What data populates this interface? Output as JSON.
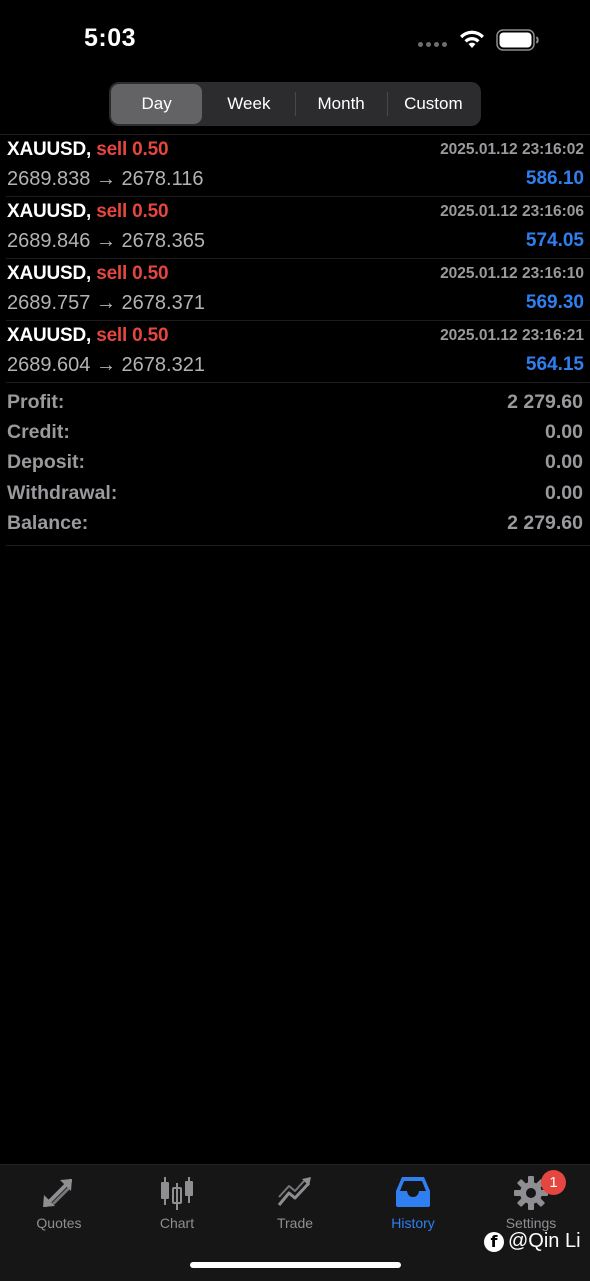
{
  "status_bar": {
    "time": "5:03"
  },
  "segments": [
    {
      "label": "Day",
      "active": true
    },
    {
      "label": "Week",
      "active": false
    },
    {
      "label": "Month",
      "active": false
    },
    {
      "label": "Custom",
      "active": false
    }
  ],
  "deals": [
    {
      "symbol": "XAUUSD,",
      "side": "sell 0.50",
      "time": "2025.01.12 23:16:02",
      "open": "2689.838",
      "arrow": "→",
      "close": "2678.116",
      "profit": "586.10"
    },
    {
      "symbol": "XAUUSD,",
      "side": "sell 0.50",
      "time": "2025.01.12 23:16:06",
      "open": "2689.846",
      "arrow": "→",
      "close": "2678.365",
      "profit": "574.05"
    },
    {
      "symbol": "XAUUSD,",
      "side": "sell 0.50",
      "time": "2025.01.12 23:16:10",
      "open": "2689.757",
      "arrow": "→",
      "close": "2678.371",
      "profit": "569.30"
    },
    {
      "symbol": "XAUUSD,",
      "side": "sell 0.50",
      "time": "2025.01.12 23:16:21",
      "open": "2689.604",
      "arrow": "→",
      "close": "2678.321",
      "profit": "564.15"
    }
  ],
  "summary": [
    {
      "label": "Profit:",
      "value": "2 279.60"
    },
    {
      "label": "Credit:",
      "value": "0.00"
    },
    {
      "label": "Deposit:",
      "value": "0.00"
    },
    {
      "label": "Withdrawal:",
      "value": "0.00"
    },
    {
      "label": "Balance:",
      "value": "2 279.60"
    }
  ],
  "tabs": [
    {
      "label": "Quotes",
      "icon": "quotes-arrows-icon",
      "active": false
    },
    {
      "label": "Chart",
      "icon": "candlestick-icon",
      "active": false
    },
    {
      "label": "Trade",
      "icon": "trade-trend-icon",
      "active": false
    },
    {
      "label": "History",
      "icon": "history-inbox-icon",
      "active": true
    },
    {
      "label": "Settings",
      "icon": "gear-icon",
      "active": false
    }
  ],
  "settings_badge": "1",
  "watermark": {
    "icon": "facebook-icon",
    "text": "@Qin Li"
  },
  "colors": {
    "sell": "#e5463f",
    "profit": "#2f7ff0",
    "active_tab": "#2f7ff0",
    "muted": "#9a9a9e"
  }
}
